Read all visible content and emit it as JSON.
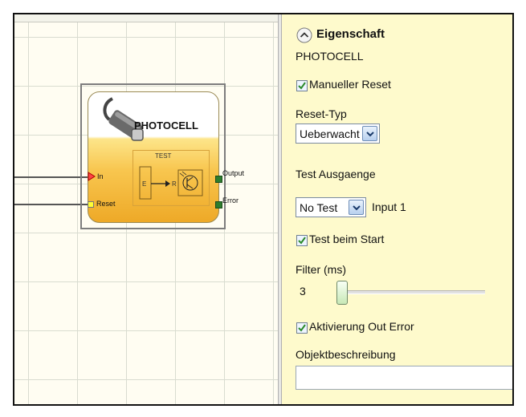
{
  "block": {
    "title": "PHOTOCELL",
    "test_label": "TEST",
    "inputs": {
      "in": "In",
      "reset": "Reset"
    },
    "outputs": {
      "output": "Output",
      "error": "Error"
    },
    "inner": {
      "e": "E",
      "r": "R"
    }
  },
  "panel": {
    "header": "Eigenschaft",
    "subtitle": "PHOTOCELL",
    "manueller_reset": {
      "label": "Manueller Reset",
      "checked": true
    },
    "reset_typ": {
      "label": "Reset-Typ",
      "value": "Ueberwacht"
    },
    "test_ausgaenge": {
      "label": "Test Ausgaenge",
      "value": "No Test",
      "input_label": "Input 1"
    },
    "test_beim_start": {
      "label": "Test beim Start",
      "checked": true
    },
    "filter": {
      "label": "Filter (ms)",
      "value": "3"
    },
    "aktivierung_out_error": {
      "label": "Aktivierung Out Error",
      "checked": true
    },
    "objektbeschreibung": {
      "label": "Objektbeschreibung",
      "value": ""
    }
  },
  "colors": {
    "panel_bg": "#fefacc",
    "port_input": "#ff4444",
    "port_reset": "#ffff33",
    "port_output": "#2d7d2d",
    "check": "#2a8a2a"
  }
}
